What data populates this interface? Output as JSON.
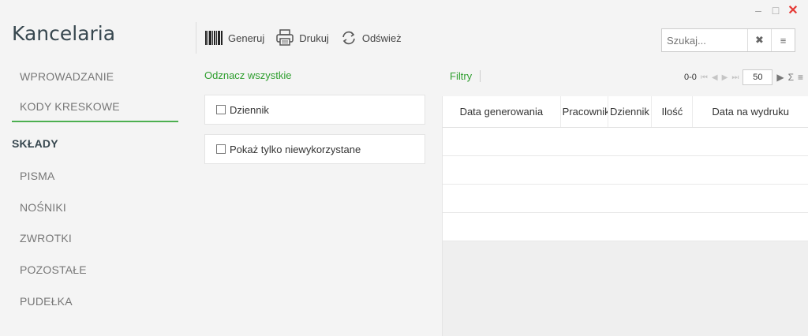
{
  "window": {
    "minimize": "–",
    "maximize": "□",
    "close": "✕"
  },
  "app": {
    "title": "Kancelaria"
  },
  "sidebar": {
    "items": [
      {
        "label": "WPROWADZANIE"
      },
      {
        "label": "KODY KRESKOWE",
        "active": true
      },
      {
        "label": "SKŁADY",
        "section": true
      },
      {
        "label": "PISMA"
      },
      {
        "label": "NOŚNIKI"
      },
      {
        "label": "ZWROTKI"
      },
      {
        "label": "POZOSTAŁE"
      },
      {
        "label": "PUDEŁKA"
      }
    ]
  },
  "toolbar": {
    "generate_label": "Generuj",
    "print_label": "Drukuj",
    "refresh_label": "Odśwież"
  },
  "search": {
    "placeholder": "Szukaj...",
    "clear_icon": "✖",
    "menu_icon": "≡"
  },
  "filters": {
    "mark_all": "Odznacz wszystkie",
    "options": [
      {
        "label": "Dziennik",
        "checked": false
      },
      {
        "label": "Pokaż tylko niewykorzystane",
        "checked": false
      }
    ]
  },
  "grid": {
    "filters_label": "Filtry",
    "pager": {
      "range": "0-0",
      "page_size": "50",
      "sum_icon": "Σ",
      "menu_icon": "≡"
    },
    "columns": [
      "Data generowania",
      "Pracownik",
      "Dziennik",
      "Ilość",
      "Data na wydruku"
    ],
    "rows": [
      [],
      [],
      [],
      []
    ]
  },
  "colors": {
    "accent": "#4caf50",
    "link": "#2e9e2e",
    "close": "#e53935"
  }
}
